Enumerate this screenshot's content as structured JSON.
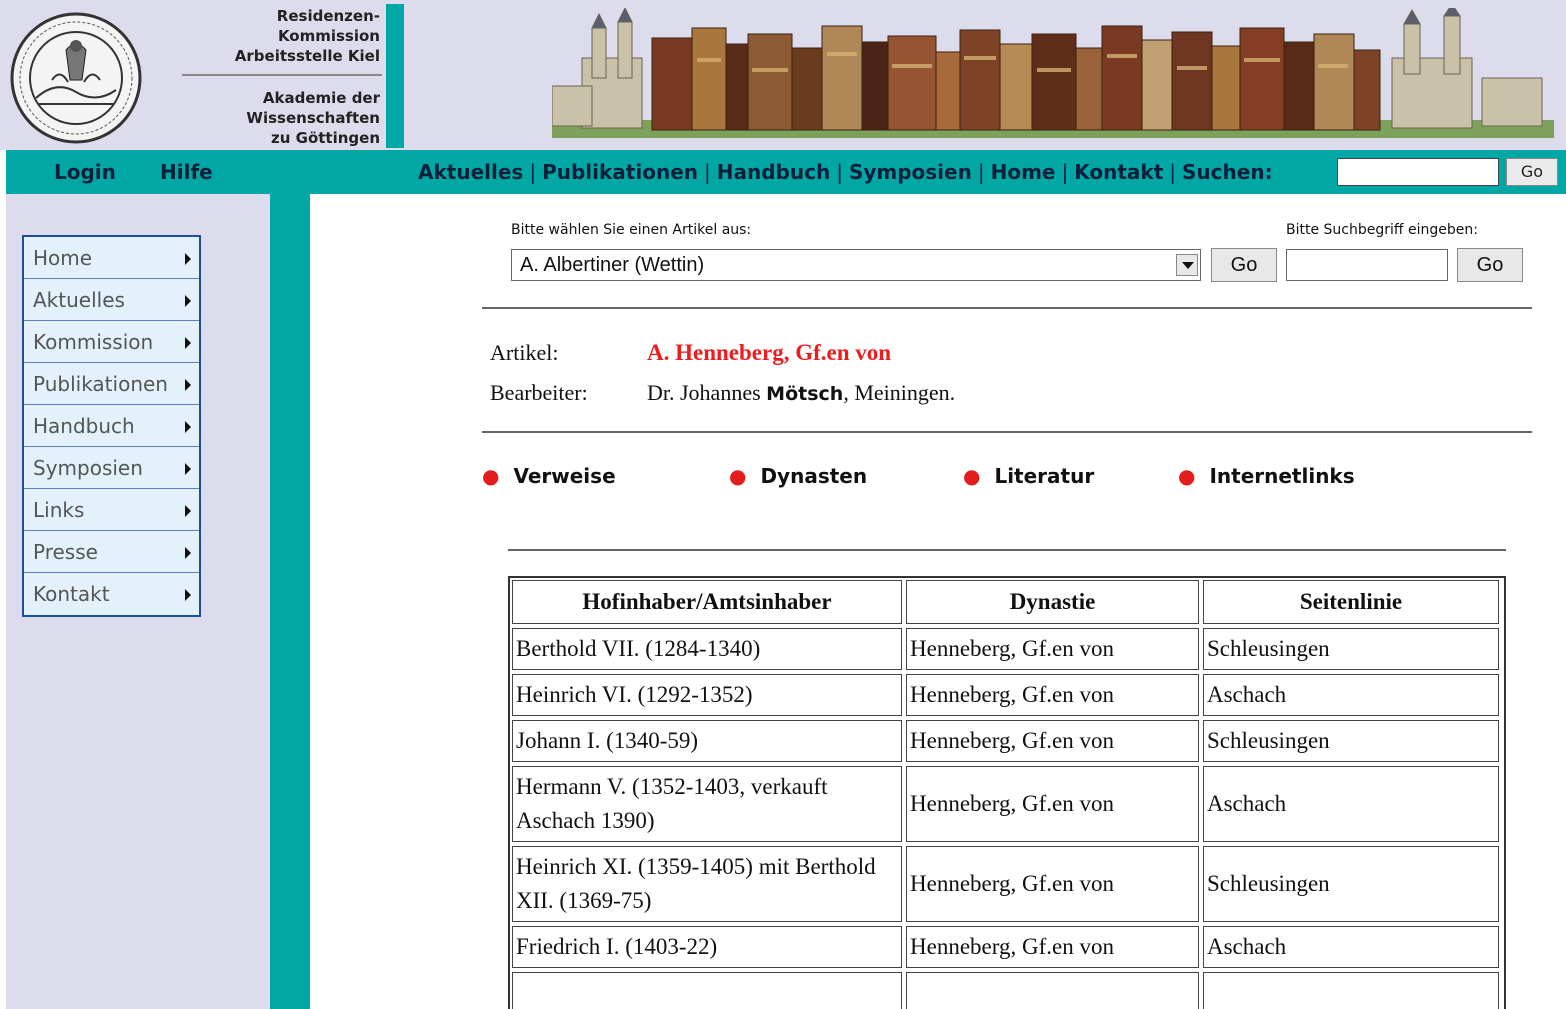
{
  "header": {
    "org_top": [
      "Residenzen-",
      "Kommission",
      "Arbeitsstelle Kiel"
    ],
    "org_bottom": [
      "Akademie der",
      "Wissenschaften",
      "zu Göttingen"
    ]
  },
  "navbar": {
    "login": "Login",
    "help": "Hilfe",
    "links": [
      "Aktuelles",
      "Publikationen",
      "Handbuch",
      "Symposien",
      "Home",
      "Kontakt",
      "Suchen:"
    ],
    "separator": "|",
    "go_label": "Go"
  },
  "sidebar": {
    "items": [
      "Home",
      "Aktuelles",
      "Kommission",
      "Publikationen",
      "Handbuch",
      "Symposien",
      "Links",
      "Presse",
      "Kontakt"
    ]
  },
  "article_picker": {
    "label": "Bitte wählen Sie einen Artikel aus:",
    "selected": "A. Albertiner (Wettin)",
    "go_label": "Go"
  },
  "keyword_search": {
    "label": "Bitte Suchbegriff eingeben:",
    "value": "",
    "go_label": "Go"
  },
  "article": {
    "artikel_label": "Artikel:",
    "artikel_value": "A. Henneberg, Gf.en von",
    "bearbeiter_label": "Bearbeiter:",
    "bearbeiter_pre": "Dr. Johannes ",
    "bearbeiter_name": "Mötsch",
    "bearbeiter_post": ", Meiningen."
  },
  "section_links": [
    "Verweise",
    "Dynasten",
    "Literatur",
    "Internetlinks"
  ],
  "table": {
    "headers": [
      "Hofinhaber/Amtsinhaber",
      "Dynastie",
      "Seitenlinie"
    ],
    "rows": [
      [
        "Berthold VII. (1284-1340)",
        "Henneberg, Gf.en von",
        "Schleusingen"
      ],
      [
        "Heinrich VI. (1292-1352)",
        "Henneberg, Gf.en von",
        "Aschach"
      ],
      [
        "Johann I. (1340-59)",
        "Henneberg, Gf.en von",
        "Schleusingen"
      ],
      [
        "Hermann V. (1352-1403, verkauft Aschach 1390)",
        "Henneberg, Gf.en von",
        "Aschach"
      ],
      [
        "Heinrich XI. (1359-1405) mit Berthold XII. (1369-75)",
        "Henneberg, Gf.en von",
        "Schleusingen"
      ],
      [
        "Friedrich I. (1403-22)",
        "Henneberg, Gf.en von",
        "Aschach"
      ]
    ]
  },
  "colors": {
    "teal": "#00a7a5",
    "lavender": "#dcdcec",
    "navy_text": "#0b1f3a",
    "accent_red": "#ee1c1c",
    "menu_border": "#1d4f9a",
    "menu_bg": "#e3f1fb"
  }
}
